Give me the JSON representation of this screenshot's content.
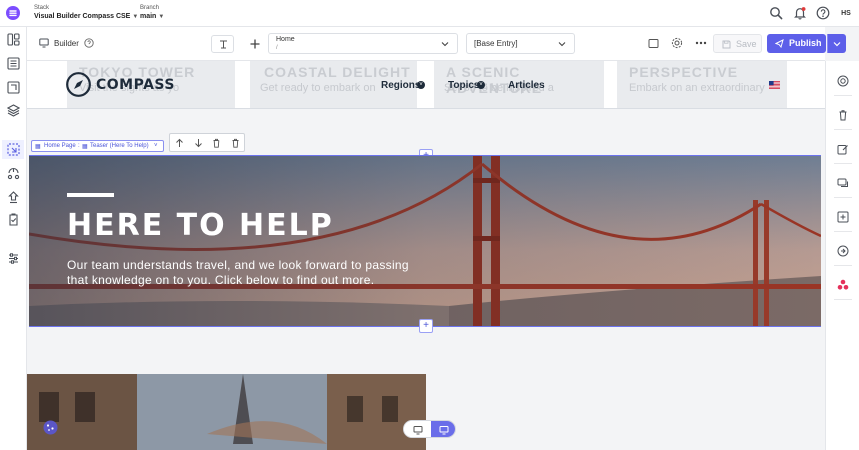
{
  "topbar": {
    "stack_label": "Stack",
    "stack_value": "Visual Builder Compass CSE",
    "branch_label": "Branch",
    "branch_value": "main",
    "avatar_initials": "HS",
    "icons": [
      "search-icon",
      "bell-icon",
      "help-icon"
    ]
  },
  "toolbar": {
    "builder_label": "Builder",
    "page_title": "Home",
    "page_path": "/",
    "entry_select": "[Base Entry]",
    "save_label": "Save",
    "publish_label": "Publish"
  },
  "header_preview": {
    "logo_text": "COMPASS",
    "nav": [
      {
        "label": "Regions"
      },
      {
        "label": "Topics"
      },
      {
        "label": "Articles"
      }
    ],
    "ghost_cards": [
      {
        "title": "TOKYO TOWER",
        "subtitle": "Visit the sights as yo"
      },
      {
        "title": "COASTAL DELIGHT",
        "subtitle": "Get ready to embark on"
      },
      {
        "title": "A SCENIC ADVENTURE",
        "subtitle": "Set off to be inspired a"
      },
      {
        "title": "PERSPECTIVE",
        "subtitle": "Embark on an extraordinary"
      }
    ]
  },
  "selection": {
    "crumb_page": "Home Page",
    "crumb_component": "Teaser (Here To Help)"
  },
  "hero": {
    "title": "HERE TO HELP",
    "text": "Our team understands travel, and we look forward to passing that knowledge on to you. Click below to find out more."
  },
  "colors": {
    "accent": "#5a5fe0",
    "publish": "#5d5fe9",
    "brand_purple": "#6c47ff",
    "nav_text": "#1e2b3a"
  }
}
